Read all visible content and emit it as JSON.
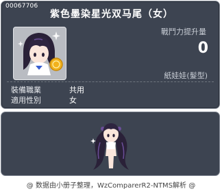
{
  "item": {
    "id": "00067706",
    "name": "紫色墨染星光双马尾（女）",
    "stat_label": "戰鬥力提升量",
    "stat_value": "0",
    "category": "紙娃娃(髮型)"
  },
  "requirements": [
    {
      "label": "裝備職業",
      "value": "共用"
    },
    {
      "label": "適用性別",
      "value": "女"
    }
  ],
  "footer": {
    "text": "@ 数据由小册子整理，WzComparerR2-NTMS解析 @"
  },
  "icons": {
    "item_icon": "hairstyle-portrait-icon",
    "preview": "character-avatar-preview"
  },
  "colors": {
    "panel_bg": "#3d4451",
    "border": "#7a818d",
    "hair": "#2a2138",
    "hair_highlight": "#6c4f9a"
  }
}
